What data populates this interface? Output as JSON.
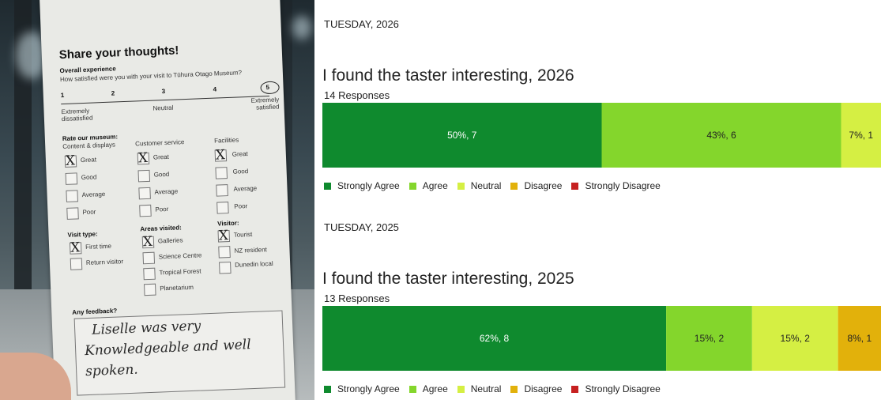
{
  "card": {
    "title": "Share your thoughts!",
    "overall_heading": "Overall experience",
    "question": "How satisfied were you with your visit to Tūhura Otago Museum?",
    "scale_numbers": [
      "1",
      "2",
      "3",
      "4",
      "5"
    ],
    "scale_selected": "5",
    "scale_left": "Extremely dissatisfied",
    "scale_mid": "Neutral",
    "scale_right": "Extremely satisfied",
    "rate_heading": "Rate our museum:",
    "columns": [
      {
        "heading": "Content & displays",
        "options": [
          "Great",
          "Good",
          "Average",
          "Poor"
        ],
        "checked": "Great"
      },
      {
        "heading": "Customer service",
        "options": [
          "Great",
          "Good",
          "Average",
          "Poor"
        ],
        "checked": "Great"
      },
      {
        "heading": "Facilities",
        "options": [
          "Great",
          "Good",
          "Average",
          "Poor"
        ],
        "checked": "Great"
      }
    ],
    "visit_type": {
      "heading": "Visit type:",
      "options": [
        "First time",
        "Return visitor"
      ],
      "checked": "First time"
    },
    "areas": {
      "heading": "Areas visited:",
      "options": [
        "Galleries",
        "Science Centre",
        "Tropical Forest",
        "Planetarium"
      ],
      "checked": "Galleries"
    },
    "visitor": {
      "heading": "Visitor:",
      "options": [
        "Tourist",
        "NZ resident",
        "Dunedin local"
      ],
      "checked": "Tourist"
    },
    "feedback_heading": "Any feedback?",
    "feedback_lines": [
      "Liselle was very",
      "Knowledgeable and well",
      "spoken."
    ]
  },
  "colors": {
    "strongly_agree": "#0f8a2e",
    "agree": "#84d62c",
    "neutral": "#d5ef43",
    "disagree": "#e2b10b",
    "strongly_disagree": "#c62020"
  },
  "chart_data": [
    {
      "type": "bar",
      "orientation": "stacked-horizontal",
      "date": "TUESDAY, 2026",
      "title": "I found the taster interesting, 2026",
      "responses_label": "14 Responses",
      "categories": [
        "Strongly Agree",
        "Agree",
        "Neutral",
        "Disagree",
        "Strongly Disagree"
      ],
      "percent": [
        50,
        43,
        7,
        0,
        0
      ],
      "counts": [
        7,
        6,
        1,
        0,
        0
      ],
      "labels": [
        "50%, 7",
        "43%, 6",
        "7%, 1",
        "",
        ""
      ]
    },
    {
      "type": "bar",
      "orientation": "stacked-horizontal",
      "date": "TUESDAY, 2025",
      "title": "I found the taster interesting, 2025",
      "responses_label": "13 Responses",
      "categories": [
        "Strongly Agree",
        "Agree",
        "Neutral",
        "Disagree",
        "Strongly Disagree"
      ],
      "percent": [
        62,
        15,
        15,
        8,
        0
      ],
      "counts": [
        8,
        2,
        2,
        1,
        0
      ],
      "labels": [
        "62%, 8",
        "15%, 2",
        "15%, 2",
        "8%, 1",
        ""
      ]
    }
  ]
}
